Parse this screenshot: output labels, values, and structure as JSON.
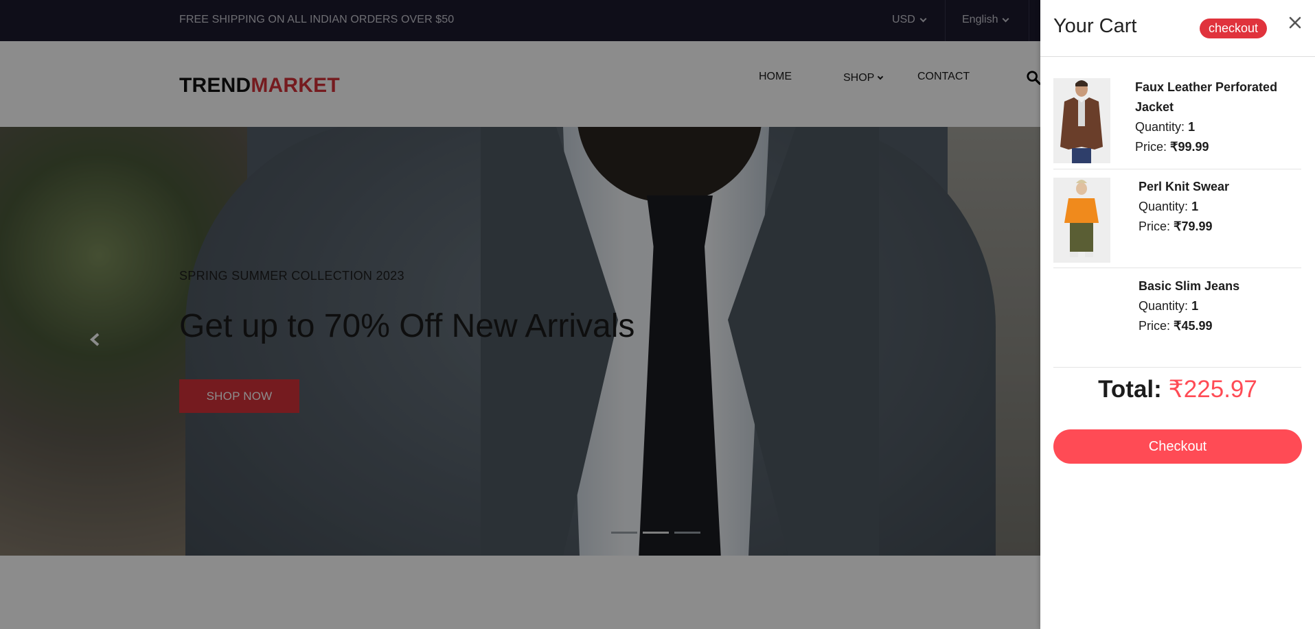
{
  "topbar": {
    "shipping_notice": "FREE SHIPPING ON ALL INDIAN ORDERS OVER $50",
    "currency": "USD",
    "language": "English"
  },
  "header": {
    "logo_part1": "TREND",
    "logo_part2": "MARKET",
    "nav": {
      "home": "HOME",
      "shop": "SHOP",
      "contact": "CONTACT"
    }
  },
  "hero": {
    "kicker": "SPRING SUMMER COLLECTION 2023",
    "headline": "Get up to 70% Off New Arrivals",
    "cta": "SHOP NOW",
    "slide_count": 3,
    "active_slide": 2
  },
  "cart": {
    "title": "Your Cart",
    "checkout_pill": "checkout",
    "quantity_label": "Quantity:",
    "price_label": "Price:",
    "items": [
      {
        "name": "Faux Leather Perforated Jacket",
        "quantity": "1",
        "price": "₹99.99"
      },
      {
        "name": "Perl Knit Swear",
        "quantity": "1",
        "price": "₹79.99"
      },
      {
        "name": "Basic Slim Jeans",
        "quantity": "1",
        "price": "₹45.99"
      }
    ],
    "total_label": "Total:",
    "total_value": "₹225.97",
    "checkout_button": "Checkout"
  },
  "colors": {
    "topbar_bg": "#1c1a2e",
    "brand_red": "#d6323a",
    "cart_accent": "#ff4b55"
  }
}
